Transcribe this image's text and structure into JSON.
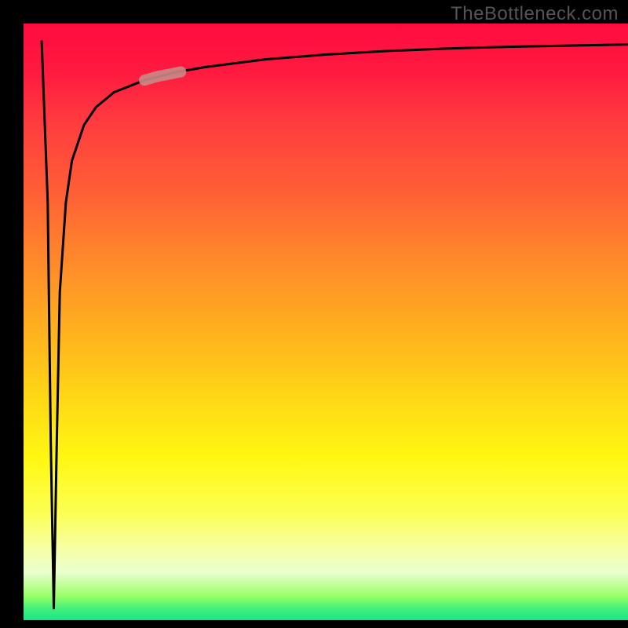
{
  "watermark": "TheBottleneck.com",
  "chart_data": {
    "type": "line",
    "title": "",
    "xlabel": "",
    "ylabel": "",
    "xlim": [
      0,
      100
    ],
    "ylim": [
      0,
      100
    ],
    "gradient_description": "vertical background gradient from red (top, high bottleneck) through orange, yellow, to green (bottom, low bottleneck)",
    "series": [
      {
        "name": "Black V-curve (bottleneck %)",
        "desc": "starts near top at x≈3, plunges to ~0 at x≈5, then rises sharply as log-like curve approaching ~95–97 as x→100",
        "x": [
          3,
          4,
          4.5,
          5,
          5.5,
          6,
          7,
          8,
          10,
          12,
          15,
          20,
          25,
          30,
          40,
          50,
          60,
          70,
          80,
          90,
          100
        ],
        "y": [
          97,
          70,
          30,
          2,
          30,
          55,
          70,
          77,
          83,
          86,
          88.5,
          90.5,
          91.8,
          92.7,
          94,
          94.8,
          95.4,
          95.8,
          96.1,
          96.3,
          96.5
        ]
      },
      {
        "name": "Highlighted segment (selected configuration)",
        "desc": "short semi-transparent pinkish band overlaying curve around x≈20–26, y≈90–92",
        "x": [
          20,
          22,
          24,
          26
        ],
        "y": [
          90.5,
          91.1,
          91.5,
          91.9
        ]
      }
    ]
  }
}
